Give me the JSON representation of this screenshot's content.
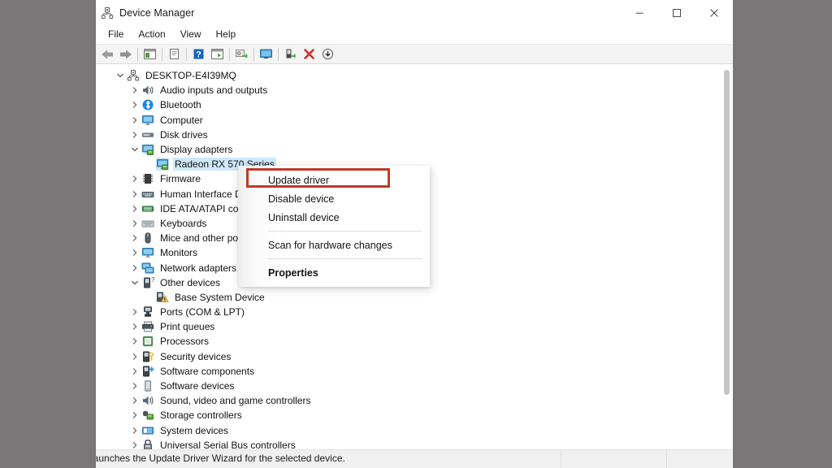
{
  "window": {
    "title": "Device Manager",
    "title_icon": "device-manager-icon",
    "controls": {
      "minimize": "minimize-icon",
      "maximize": "maximize-icon",
      "close": "close-icon"
    }
  },
  "menubar": {
    "items": [
      {
        "label": "File"
      },
      {
        "label": "Action"
      },
      {
        "label": "View"
      },
      {
        "label": "Help"
      }
    ]
  },
  "toolbar": {
    "buttons": [
      {
        "name": "back-icon"
      },
      {
        "name": "forward-icon"
      },
      {
        "name": "show-hide-console-tree-icon"
      },
      {
        "name": "properties-icon"
      },
      {
        "name": "help-icon"
      },
      {
        "name": "view-icon"
      },
      {
        "name": "update-driver-icon"
      },
      {
        "name": "scan-for-hardware-changes-icon"
      },
      {
        "name": "enable-device-icon"
      },
      {
        "name": "uninstall-device-icon"
      },
      {
        "name": "download-icon"
      }
    ]
  },
  "tree": {
    "nodes": [
      {
        "label": "DESKTOP-E4I39MQ",
        "depth": 0,
        "state": "expanded",
        "icon": "computer-root-icon"
      },
      {
        "label": "Audio inputs and outputs",
        "depth": 1,
        "state": "collapsed",
        "icon": "speaker-icon"
      },
      {
        "label": "Bluetooth",
        "depth": 1,
        "state": "collapsed",
        "icon": "bluetooth-icon"
      },
      {
        "label": "Computer",
        "depth": 1,
        "state": "collapsed",
        "icon": "monitor-icon"
      },
      {
        "label": "Disk drives",
        "depth": 1,
        "state": "collapsed",
        "icon": "disk-drive-icon"
      },
      {
        "label": "Display adapters",
        "depth": 1,
        "state": "expanded",
        "icon": "display-adapter-icon"
      },
      {
        "label": "Radeon RX 570 Series",
        "depth": 2,
        "state": "leaf",
        "icon": "display-adapter-icon",
        "selected": true
      },
      {
        "label": "Firmware",
        "depth": 1,
        "state": "collapsed",
        "icon": "firmware-icon"
      },
      {
        "label": "Human Interface Dev",
        "depth": 1,
        "state": "collapsed",
        "icon": "hid-icon"
      },
      {
        "label": "IDE ATA/ATAPI contro",
        "depth": 1,
        "state": "collapsed",
        "icon": "ide-controller-icon"
      },
      {
        "label": "Keyboards",
        "depth": 1,
        "state": "collapsed",
        "icon": "keyboard-icon"
      },
      {
        "label": "Mice and other pointi",
        "depth": 1,
        "state": "collapsed",
        "icon": "mouse-icon"
      },
      {
        "label": "Monitors",
        "depth": 1,
        "state": "collapsed",
        "icon": "monitor-icon"
      },
      {
        "label": "Network adapters",
        "depth": 1,
        "state": "collapsed",
        "icon": "network-adapter-icon"
      },
      {
        "label": "Other devices",
        "depth": 1,
        "state": "expanded",
        "icon": "other-device-icon"
      },
      {
        "label": "Base System Device",
        "depth": 2,
        "state": "leaf",
        "icon": "unknown-device-warning-icon"
      },
      {
        "label": "Ports (COM & LPT)",
        "depth": 1,
        "state": "collapsed",
        "icon": "port-icon"
      },
      {
        "label": "Print queues",
        "depth": 1,
        "state": "collapsed",
        "icon": "printer-icon"
      },
      {
        "label": "Processors",
        "depth": 1,
        "state": "collapsed",
        "icon": "processor-icon"
      },
      {
        "label": "Security devices",
        "depth": 1,
        "state": "collapsed",
        "icon": "security-device-icon"
      },
      {
        "label": "Software components",
        "depth": 1,
        "state": "collapsed",
        "icon": "software-component-icon"
      },
      {
        "label": "Software devices",
        "depth": 1,
        "state": "collapsed",
        "icon": "software-device-icon"
      },
      {
        "label": "Sound, video and game controllers",
        "depth": 1,
        "state": "collapsed",
        "icon": "speaker-icon"
      },
      {
        "label": "Storage controllers",
        "depth": 1,
        "state": "collapsed",
        "icon": "storage-controller-icon"
      },
      {
        "label": "System devices",
        "depth": 1,
        "state": "collapsed",
        "icon": "system-device-icon"
      },
      {
        "label": "Universal Serial Bus controllers",
        "depth": 1,
        "state": "collapsed",
        "icon": "usb-controller-icon"
      }
    ]
  },
  "context_menu": {
    "items": [
      {
        "label": "Update driver",
        "type": "item",
        "bold": false,
        "highlighted": true
      },
      {
        "label": "Disable device",
        "type": "item",
        "bold": false
      },
      {
        "label": "Uninstall device",
        "type": "item",
        "bold": false
      },
      {
        "type": "separator"
      },
      {
        "label": "Scan for hardware changes",
        "type": "item",
        "bold": false
      },
      {
        "type": "separator"
      },
      {
        "label": "Properties",
        "type": "item",
        "bold": true
      }
    ],
    "highlight_color": "#c0392b"
  },
  "statusbar": {
    "text": "Launches the Update Driver Wizard for the selected device."
  }
}
